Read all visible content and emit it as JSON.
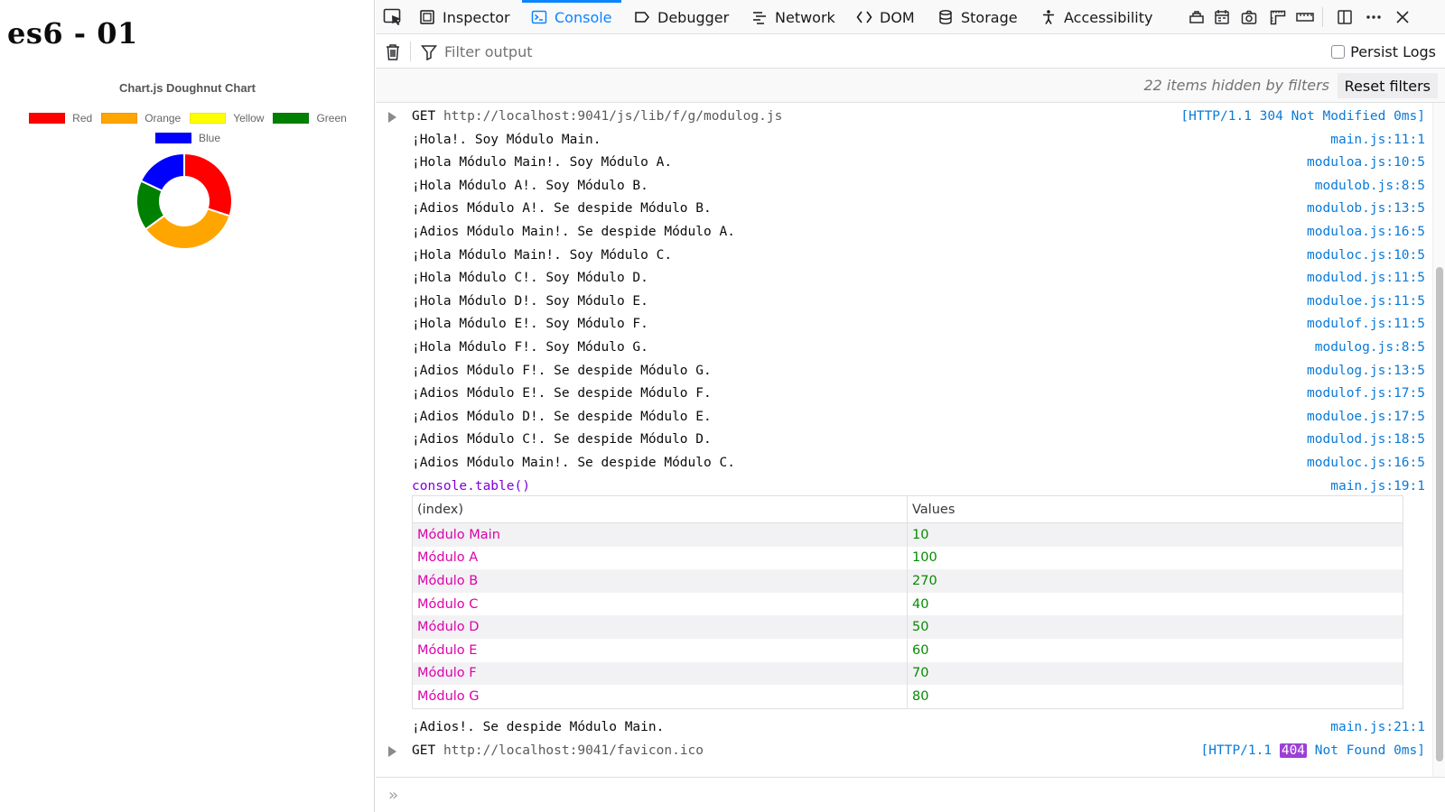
{
  "page": {
    "title": "es6 - 01",
    "chart": {
      "title": "Chart.js Doughnut Chart"
    }
  },
  "chart_data": {
    "type": "pie",
    "doughnut": true,
    "title": "Chart.js Doughnut Chart",
    "categories": [
      "Red",
      "Orange",
      "Yellow",
      "Green",
      "Blue"
    ],
    "values": [
      30,
      35,
      0,
      17,
      18
    ],
    "colors": [
      "#ff0000",
      "#ffa500",
      "#ffff00",
      "#008000",
      "#0000ff"
    ],
    "legend_position": "top"
  },
  "devtools": {
    "tabs": [
      {
        "label": "Inspector",
        "icon": "inspector-icon"
      },
      {
        "label": "Console",
        "icon": "console-icon",
        "active": true
      },
      {
        "label": "Debugger",
        "icon": "debugger-icon"
      },
      {
        "label": "Network",
        "icon": "network-icon"
      },
      {
        "label": "DOM",
        "icon": "dom-icon"
      },
      {
        "label": "Storage",
        "icon": "storage-icon"
      },
      {
        "label": "Accessibility",
        "icon": "accessibility-icon"
      }
    ],
    "filter": {
      "placeholder": "Filter output",
      "persist_label": "Persist Logs"
    },
    "hidden_info": "22 items hidden by filters",
    "reset_label": "Reset filters",
    "log": [
      {
        "kind": "net",
        "method": "GET",
        "url": "http://localhost:9041/js/lib/f/g/modulog.js",
        "location": "[HTTP/1.1 304 Not Modified 0ms]"
      },
      {
        "kind": "log",
        "text": "¡Hola!. Soy Módulo Main.",
        "location": "main.js:11:1"
      },
      {
        "kind": "log",
        "text": "¡Hola Módulo Main!. Soy Módulo A.",
        "location": "moduloa.js:10:5"
      },
      {
        "kind": "log",
        "text": "¡Hola Módulo A!. Soy Módulo B.",
        "location": "modulob.js:8:5"
      },
      {
        "kind": "log",
        "text": "¡Adios Módulo A!. Se despide Módulo B.",
        "location": "modulob.js:13:5"
      },
      {
        "kind": "log",
        "text": "¡Adios Módulo Main!. Se despide Módulo A.",
        "location": "moduloa.js:16:5"
      },
      {
        "kind": "log",
        "text": "¡Hola Módulo Main!. Soy Módulo C.",
        "location": "moduloc.js:10:5"
      },
      {
        "kind": "log",
        "text": "¡Hola Módulo C!. Soy Módulo D.",
        "location": "modulod.js:11:5"
      },
      {
        "kind": "log",
        "text": "¡Hola Módulo D!. Soy Módulo E.",
        "location": "moduloe.js:11:5"
      },
      {
        "kind": "log",
        "text": "¡Hola Módulo E!. Soy Módulo F.",
        "location": "modulof.js:11:5"
      },
      {
        "kind": "log",
        "text": "¡Hola Módulo F!. Soy Módulo G.",
        "location": "modulog.js:8:5"
      },
      {
        "kind": "log",
        "text": "¡Adios Módulo F!. Se despide Módulo G.",
        "location": "modulog.js:13:5"
      },
      {
        "kind": "log",
        "text": "¡Adios Módulo E!. Se despide Módulo F.",
        "location": "modulof.js:17:5"
      },
      {
        "kind": "log",
        "text": "¡Adios Módulo D!. Se despide Módulo E.",
        "location": "moduloe.js:17:5"
      },
      {
        "kind": "log",
        "text": "¡Adios Módulo C!. Se despide Módulo D.",
        "location": "modulod.js:18:5"
      },
      {
        "kind": "log",
        "text": "¡Adios Módulo Main!. Se despide Módulo C.",
        "location": "moduloc.js:16:5"
      },
      {
        "kind": "table",
        "text": "console.table()",
        "location": "main.js:19:1"
      }
    ],
    "table": {
      "headers": [
        "(index)",
        "Values"
      ],
      "rows": [
        {
          "index": "Módulo Main",
          "value": "10"
        },
        {
          "index": "Módulo A",
          "value": "100"
        },
        {
          "index": "Módulo B",
          "value": "270"
        },
        {
          "index": "Módulo C",
          "value": "40"
        },
        {
          "index": "Módulo D",
          "value": "50"
        },
        {
          "index": "Módulo E",
          "value": "60"
        },
        {
          "index": "Módulo F",
          "value": "70"
        },
        {
          "index": "Módulo G",
          "value": "80"
        }
      ]
    },
    "log_after": [
      {
        "kind": "log",
        "text": "¡Adios!. Se despide Módulo Main.",
        "location": "main.js:21:1"
      },
      {
        "kind": "net",
        "method": "GET",
        "url": "http://localhost:9041/favicon.ico",
        "status_pre": "[HTTP/1.1 ",
        "status_code": "404",
        "status_post": " Not Found 0ms]"
      }
    ],
    "prompt": "»"
  }
}
